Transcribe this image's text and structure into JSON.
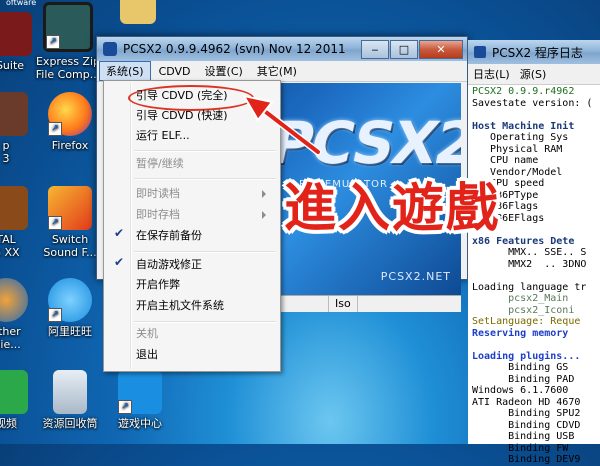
{
  "desktop": {
    "icons": [
      {
        "label": "Suite",
        "label2": ""
      },
      {
        "label": "Express Zip",
        "label2": "File Comp..."
      },
      {
        "label": "",
        "label2": ""
      },
      {
        "label": "Firefox",
        "label2": ""
      },
      {
        "label": "Switch",
        "label2": "Sound F..."
      },
      {
        "label": "阿里旺旺",
        "label2": ""
      },
      {
        "label": "资源回收筒",
        "label2": ""
      },
      {
        "label": "遊戏中心",
        "label2": ""
      },
      {
        "label": "p",
        "label2": "3"
      },
      {
        "label": "TAL",
        "label2": "G XX"
      },
      {
        "label": "ether",
        "label2": "clie..."
      },
      {
        "label": "视频",
        "label2": ""
      }
    ],
    "corner_text": "oftware"
  },
  "pcsx2_window": {
    "title": "PCSX2  0.9.9.4962 (svn)  Nov 12 2011",
    "menu": [
      "系统(S)",
      "CDVD",
      "设置(C)",
      "其它(M)"
    ],
    "banner_logo": "PCSX2",
    "banner_sub": "PS2 EMULATOR",
    "banner_net": "PCSX2.NET",
    "status": [
      "VM :",
      "Iso"
    ]
  },
  "system_menu": {
    "items": [
      {
        "label": "引导 CDVD (完全)",
        "enabled": true
      },
      {
        "label": "引导 CDVD (快速)",
        "enabled": true
      },
      {
        "label": "运行 ELF...",
        "enabled": true
      },
      {
        "label": "暂停/继续",
        "enabled": false
      },
      {
        "label": "即时读档",
        "enabled": false
      },
      {
        "label": "即时存档",
        "enabled": false
      },
      {
        "label": "在保存前备份",
        "enabled": true,
        "checked": true
      },
      {
        "label": "自动游戏修正",
        "enabled": true,
        "checked": true
      },
      {
        "label": "开启作弊",
        "enabled": true
      },
      {
        "label": "开启主机文件系统",
        "enabled": true
      },
      {
        "label": "关机",
        "enabled": false
      },
      {
        "label": "退出",
        "enabled": true
      }
    ]
  },
  "log_window": {
    "title": "PCSX2 程序日志",
    "menu": [
      "日志(L)",
      "源(S)"
    ],
    "lines": [
      {
        "t": "PCSX2 0.9.9.r4962",
        "c": "c-green"
      },
      {
        "t": "Savestate version: (",
        "c": ""
      },
      {
        "t": "",
        "c": ""
      },
      {
        "t": "Host Machine Init",
        "c": "c-bold"
      },
      {
        "t": "   Operating Sys",
        "c": ""
      },
      {
        "t": "   Physical RAM",
        "c": ""
      },
      {
        "t": "   CPU name",
        "c": ""
      },
      {
        "t": "   Vendor/Model",
        "c": ""
      },
      {
        "t": "   CPU speed",
        "c": ""
      },
      {
        "t": "   x86PType",
        "c": ""
      },
      {
        "t": "   x86Flags",
        "c": ""
      },
      {
        "t": "   x86EFlags",
        "c": ""
      },
      {
        "t": "",
        "c": ""
      },
      {
        "t": "x86 Features Dete",
        "c": "c-bold"
      },
      {
        "t": "      MMX.. SSE.. S",
        "c": ""
      },
      {
        "t": "      MMX2  .. 3DNO",
        "c": ""
      },
      {
        "t": "",
        "c": ""
      },
      {
        "t": "Loading language tr",
        "c": ""
      },
      {
        "t": "      pcsx2_Main",
        "c": "c-gray"
      },
      {
        "t": "      pcsx2_Iconi",
        "c": "c-gray"
      },
      {
        "t": "SetLanguage: Reque",
        "c": "c-olive"
      },
      {
        "t": "Reserving memory",
        "c": "c-blue"
      },
      {
        "t": "",
        "c": ""
      },
      {
        "t": "Loading plugins...",
        "c": "c-blue"
      },
      {
        "t": "      Binding GS",
        "c": ""
      },
      {
        "t": "      Binding PAD",
        "c": ""
      },
      {
        "t": "Windows 6.1.7600",
        "c": ""
      },
      {
        "t": "ATI Radeon HD 4670",
        "c": ""
      },
      {
        "t": "      Binding SPU2",
        "c": ""
      },
      {
        "t": "      Binding CDVD",
        "c": ""
      },
      {
        "t": "      Binding USB",
        "c": ""
      },
      {
        "t": "      Binding FW",
        "c": ""
      },
      {
        "t": "      Binding DEV9",
        "c": ""
      }
    ]
  },
  "overlay_text": "進入遊戲",
  "colors": {
    "annotation_red": "#e2231a"
  }
}
